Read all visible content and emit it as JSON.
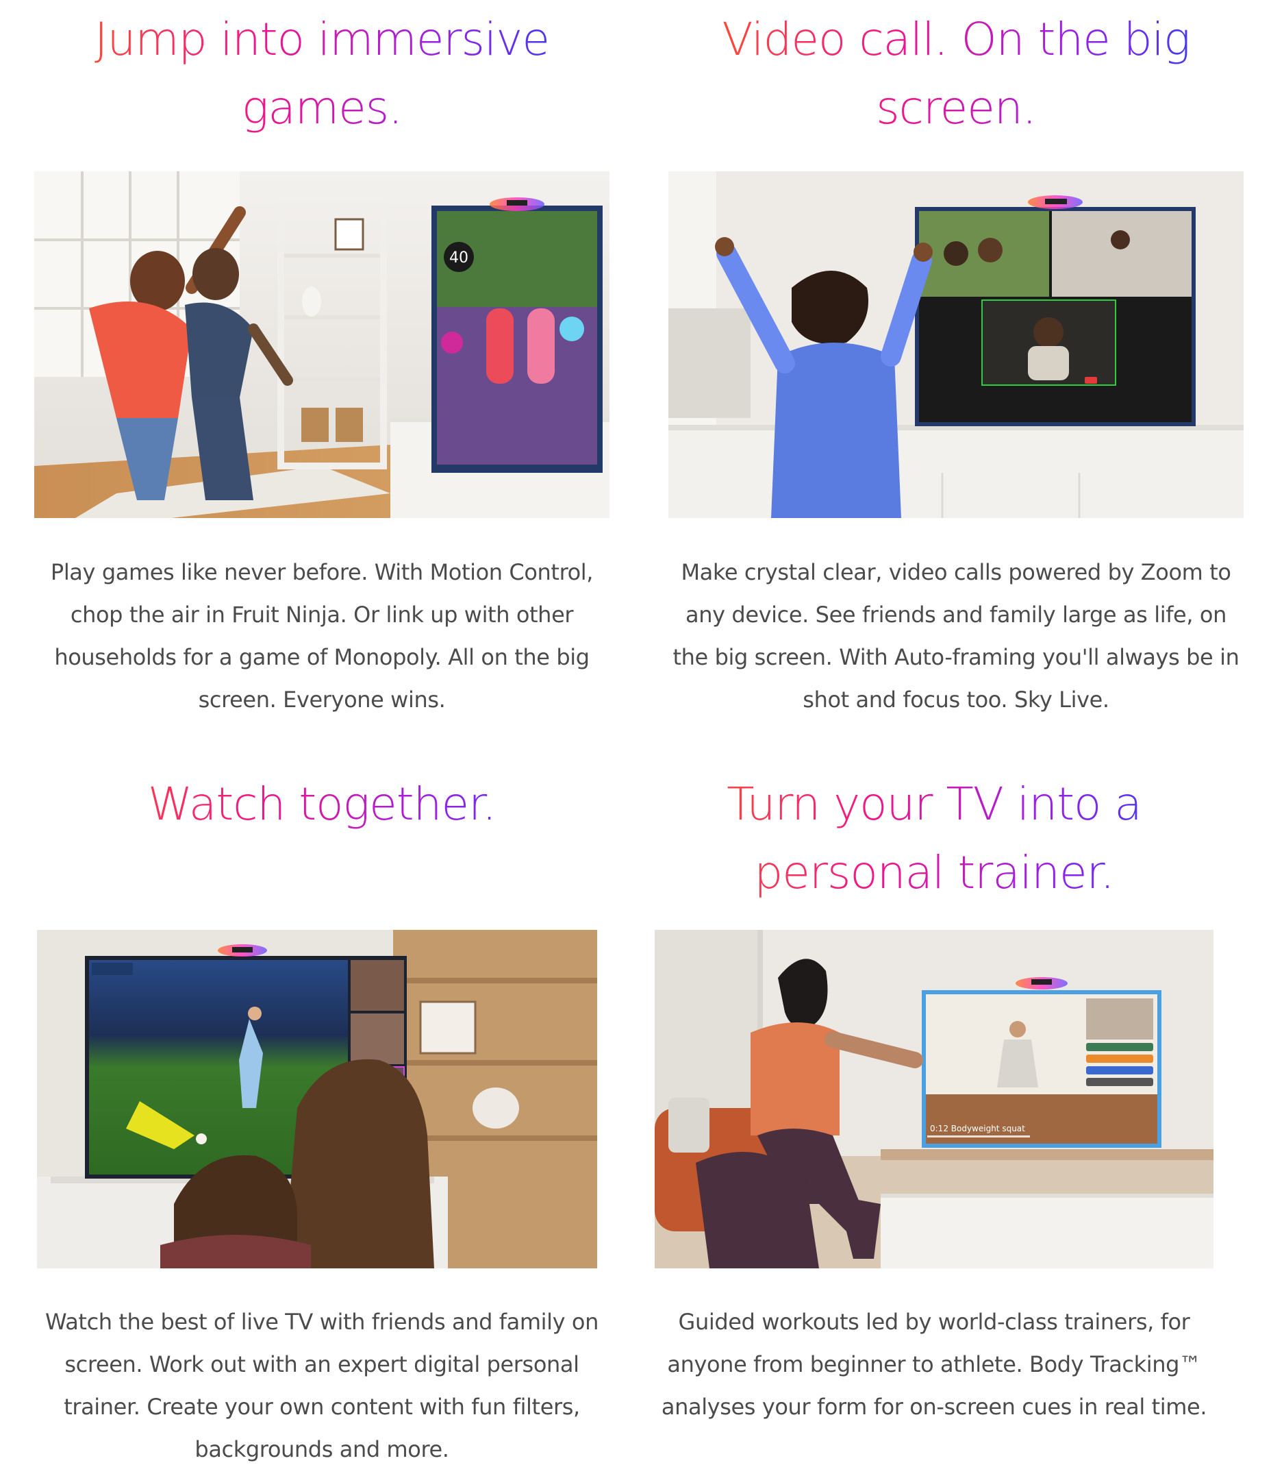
{
  "cards": [
    {
      "title_lines": [
        "Jump into immersive",
        "games."
      ],
      "description": "Play games like never before. With Motion Control, chop the air in Fruit Ninja. Or link up with other households for a game of Monopoly. All on the big screen. Everyone wins.",
      "image": {
        "tv_overlay": "40"
      }
    },
    {
      "title_lines": [
        "Video call. On the big",
        "screen."
      ],
      "description": "Make crystal clear, video calls powered by Zoom to any device. See friends and family large as life, on the big screen. With Auto-framing you'll always be in shot and focus too. Sky Live."
    },
    {
      "title_lines": [
        "Watch together."
      ],
      "description": "Watch the best of live TV with friends and family on screen. Work out with an expert digital personal trainer. Create your own content with fun filters, backgrounds and more."
    },
    {
      "title_lines": [
        "Turn your TV into a",
        "personal trainer."
      ],
      "description": "Guided workouts led by world-class trainers, for anyone from beginner to athlete. Body Tracking™ analyses your form for on-screen cues in real time.",
      "image": {
        "tv_overlay": "0:12 Bodyweight squat"
      }
    }
  ]
}
